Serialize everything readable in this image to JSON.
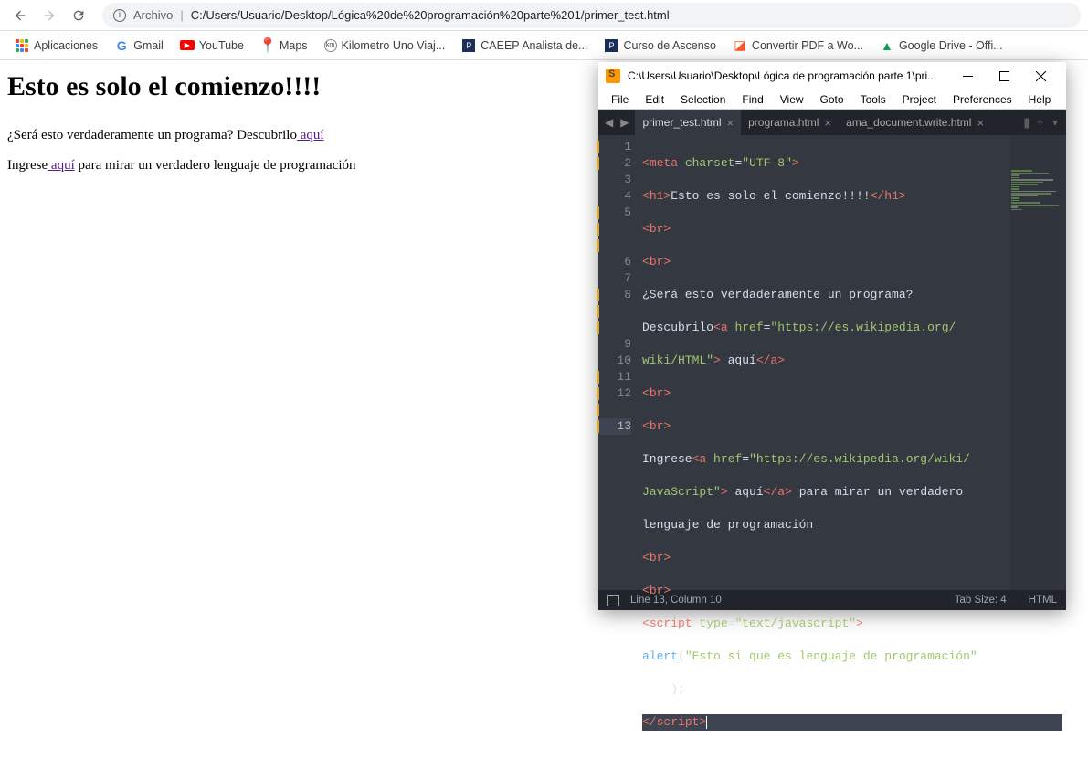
{
  "browser": {
    "url_label": "Archivo",
    "url": "C:/Users/Usuario/Desktop/Lógica%20de%20programación%20parte%201/primer_test.html"
  },
  "bookmarks": [
    {
      "label": "Aplicaciones"
    },
    {
      "label": "Gmail"
    },
    {
      "label": "YouTube"
    },
    {
      "label": "Maps"
    },
    {
      "label": "Kilometro Uno Viaj..."
    },
    {
      "label": "CAEEP Analista de..."
    },
    {
      "label": "Curso de Ascenso"
    },
    {
      "label": "Convertir PDF a Wo..."
    },
    {
      "label": "Google Drive - Offi..."
    }
  ],
  "page": {
    "h1": "Esto es solo el comienzo!!!!",
    "p1a": "¿Será esto verdaderamente un programa? Descubrilo",
    "p1link": " aquí",
    "p2a": "Ingrese",
    "p2link": " aquí",
    "p2b": " para mirar un verdadero lenguaje de programación"
  },
  "sublime": {
    "title": "C:\\Users\\Usuario\\Desktop\\Lógica de programación parte 1\\pri...",
    "menu": [
      "File",
      "Edit",
      "Selection",
      "Find",
      "View",
      "Goto",
      "Tools",
      "Project",
      "Preferences",
      "Help"
    ],
    "tabs": [
      {
        "name": "primer_test.html",
        "active": true
      },
      {
        "name": "programa.html",
        "active": false
      },
      {
        "name": "ama_document.write.html",
        "active": false
      }
    ],
    "gutter": [
      "1",
      "2",
      "3",
      "4",
      "5",
      "",
      "",
      "6",
      "7",
      "8",
      "",
      "",
      "9",
      "10",
      "11",
      "12",
      "",
      "13"
    ],
    "code": {
      "l1": {
        "a": "<",
        "b": "meta",
        "c": " charset",
        "d": "=",
        "e": "\"UTF-8\"",
        "f": ">"
      },
      "l2": {
        "a": "<",
        "b": "h1",
        "c": ">",
        "d": "Esto es solo el comienzo!!!!",
        "e": "</",
        "f": "h1",
        "g": ">"
      },
      "l3": {
        "a": "<",
        "b": "br",
        "c": ">"
      },
      "l4": {
        "a": "<",
        "b": "br",
        "c": ">"
      },
      "l5a": "¿Será esto verdaderamente un programa? ",
      "l5b": "Descubrilo",
      "l5c": {
        "a": "<",
        "b": "a",
        "c": " href",
        "d": "=",
        "e": "\"https://es.wikipedia.org/"
      },
      "l5d": {
        "a": "wiki/HTML\"",
        "b": ">",
        "c": " aquí",
        "d": "</",
        "e": "a",
        "f": ">"
      },
      "l6": {
        "a": "<",
        "b": "br",
        "c": ">"
      },
      "l7": {
        "a": "<",
        "b": "br",
        "c": ">"
      },
      "l8a": "Ingrese",
      "l8b": {
        "a": "<",
        "b": "a",
        "c": " href",
        "d": "=",
        "e": "\"https://es.wikipedia.org/wiki/"
      },
      "l8c": {
        "a": "JavaScript\"",
        "b": ">",
        "c": " aquí",
        "d": "</",
        "e": "a",
        "f": ">"
      },
      "l8d": " para mirar un verdadero ",
      "l8e": "lenguaje de programación",
      "l9": {
        "a": "<",
        "b": "br",
        "c": ">"
      },
      "l10": {
        "a": "<",
        "b": "br",
        "c": ">"
      },
      "l11": {
        "a": "<",
        "b": "script",
        "c": " type",
        "d": "=",
        "e": "\"text/javascript\"",
        "f": ">"
      },
      "l12a": "alert",
      "l12b": "(",
      "l12c": "\"Esto si que es lenguaje de programación\"",
      "l12d": "    );",
      "l13": {
        "a": "</",
        "b": "script",
        "c": ">"
      }
    },
    "status": {
      "pos": "Line 13, Column 10",
      "tab": "Tab Size: 4",
      "syntax": "HTML"
    }
  }
}
